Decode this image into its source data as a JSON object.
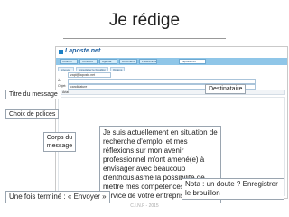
{
  "slide": {
    "title": "Je rédige",
    "footer": "C.I.N.F - 2015"
  },
  "app": {
    "logo": "Laposte.net",
    "tabs": [
      "Courrier",
      "Contacts",
      "Agenda",
      "Documents",
      "Préférences",
      "Laposte.net"
    ],
    "actions": [
      "Envoyer",
      "Enregistrer le brouillon",
      "Options"
    ],
    "from": "zapl@laposte.net",
    "to_label": "À:",
    "subject_label": "Objet:",
    "subject_value": "candidature",
    "font": "Arial"
  },
  "labels": {
    "destinataire": "Destinataire",
    "titre": "Titre du message",
    "police": "Choix de polices",
    "corps": "Corps du\nmessage",
    "envoyer": "Une fois terminé : « Envoyer »",
    "nota": "Nota : un doute ? Enregistrer\nle brouillon"
  },
  "message": "Je suis actuellement en situation de recherche d'emploi et mes réflexions sur mon avenir professionnel m'ont amené(e) à envisager avec beaucoup d'enthousiasme la possibilité de mettre mes compétences au service de votre entreprise."
}
